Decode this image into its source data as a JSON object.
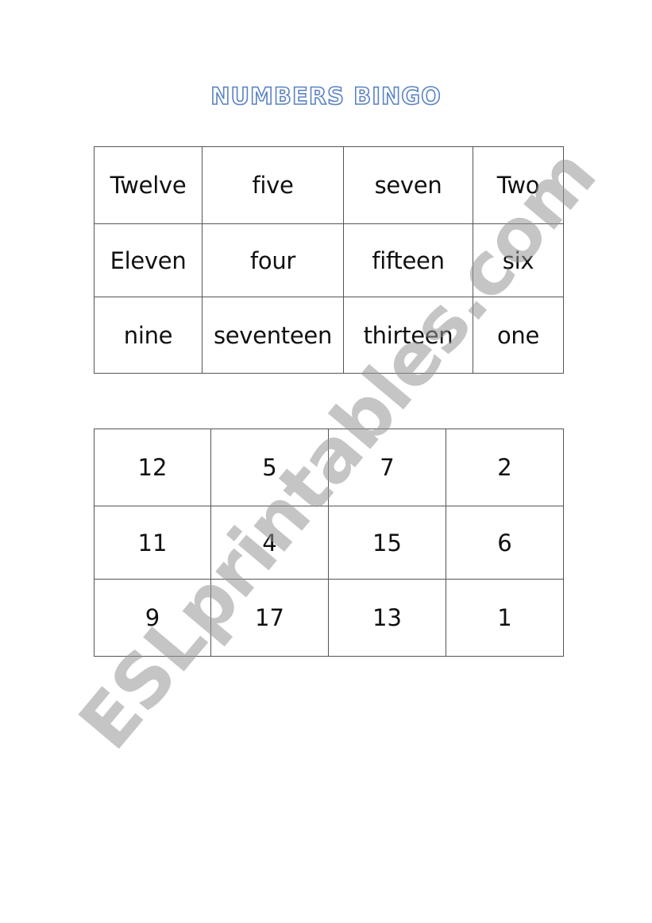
{
  "title": "NUMBERS BINGO",
  "title_color": "#5b83c4",
  "watermark": "ESLprintables.com",
  "words_table": {
    "rows": [
      [
        "Twelve",
        "five",
        "seven",
        "Two"
      ],
      [
        "Eleven",
        "four",
        "fifteen",
        "six"
      ],
      [
        "nine",
        "seventeen",
        "thirteen",
        "one"
      ]
    ]
  },
  "numbers_table": {
    "rows": [
      [
        "12",
        "5",
        "7",
        "2"
      ],
      [
        "11",
        "4",
        "15",
        "6"
      ],
      [
        "9",
        "17",
        "13",
        "1"
      ]
    ]
  }
}
